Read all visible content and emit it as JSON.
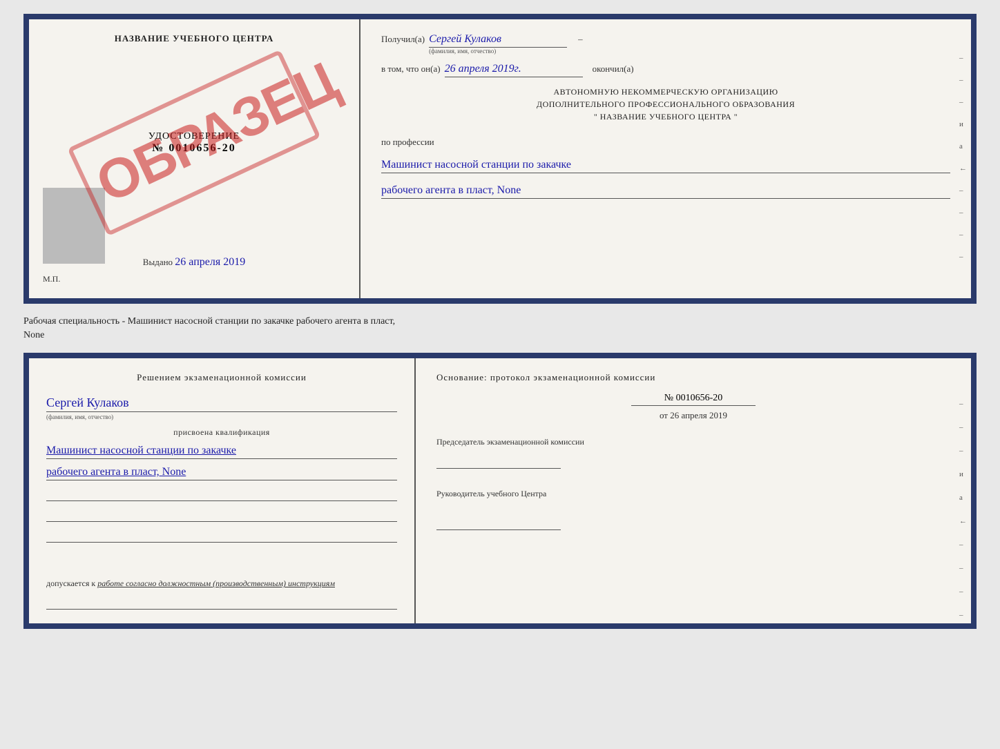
{
  "top_doc": {
    "left": {
      "title": "НАЗВАНИЕ УЧЕБНОГО ЦЕНТРА",
      "cert_label": "УДОСТОВЕРЕНИЕ",
      "cert_number": "№ 0010656-20",
      "issued_label": "Выдано",
      "issued_date": "26 апреля 2019",
      "mp_label": "М.П."
    },
    "stamp": "ОБРАЗЕЦ",
    "right": {
      "received_label": "Получил(а)",
      "received_name": "Сергей Кулаков",
      "name_hint": "(фамилия, имя, отчество)",
      "date_label": "в том, что он(а)",
      "date_value": "26 апреля 2019г.",
      "finished_label": "окончил(а)",
      "org_line1": "АВТОНОМНУЮ НЕКОММЕРЧЕСКУЮ ОРГАНИЗАЦИЮ",
      "org_line2": "ДОПОЛНИТЕЛЬНОГО ПРОФЕССИОНАЛЬНОГО ОБРАЗОВАНИЯ",
      "org_line3": "\"  НАЗВАНИЕ УЧЕБНОГО ЦЕНТРА  \"",
      "profession_label": "по профессии",
      "profession_line1": "Машинист насосной станции по закачке",
      "profession_line2": "рабочего агента в пласт, None",
      "side_marks": [
        "-",
        "-",
        "-",
        "и",
        "а",
        "←",
        "-",
        "-",
        "-",
        "-"
      ]
    }
  },
  "between_text": {
    "line1": "Рабочая специальность - Машинист насосной станции по закачке рабочего агента в пласт,",
    "line2": "None"
  },
  "bottom_doc": {
    "left": {
      "decision_title": "Решением экзаменационной комиссии",
      "person_name": "Сергей Кулаков",
      "name_hint": "(фамилия, имя, отчество)",
      "qualification_assigned": "присвоена квалификация",
      "qualification_line1": "Машинист насосной станции по закачке",
      "qualification_line2": "рабочего агента в пласт, None",
      "admission_label": "допускается к",
      "admission_text": "работе согласно должностным (производственным) инструкциям"
    },
    "right": {
      "basis_label": "Основание: протокол экзаменационной комиссии",
      "protocol_number": "№ 0010656-20",
      "protocol_date_prefix": "от",
      "protocol_date": "26 апреля 2019",
      "chairman_label": "Председатель экзаменационной комиссии",
      "director_label": "Руководитель учебного Центра",
      "side_marks": [
        "-",
        "-",
        "-",
        "и",
        "а",
        "←",
        "-",
        "-",
        "-",
        "-"
      ]
    }
  }
}
